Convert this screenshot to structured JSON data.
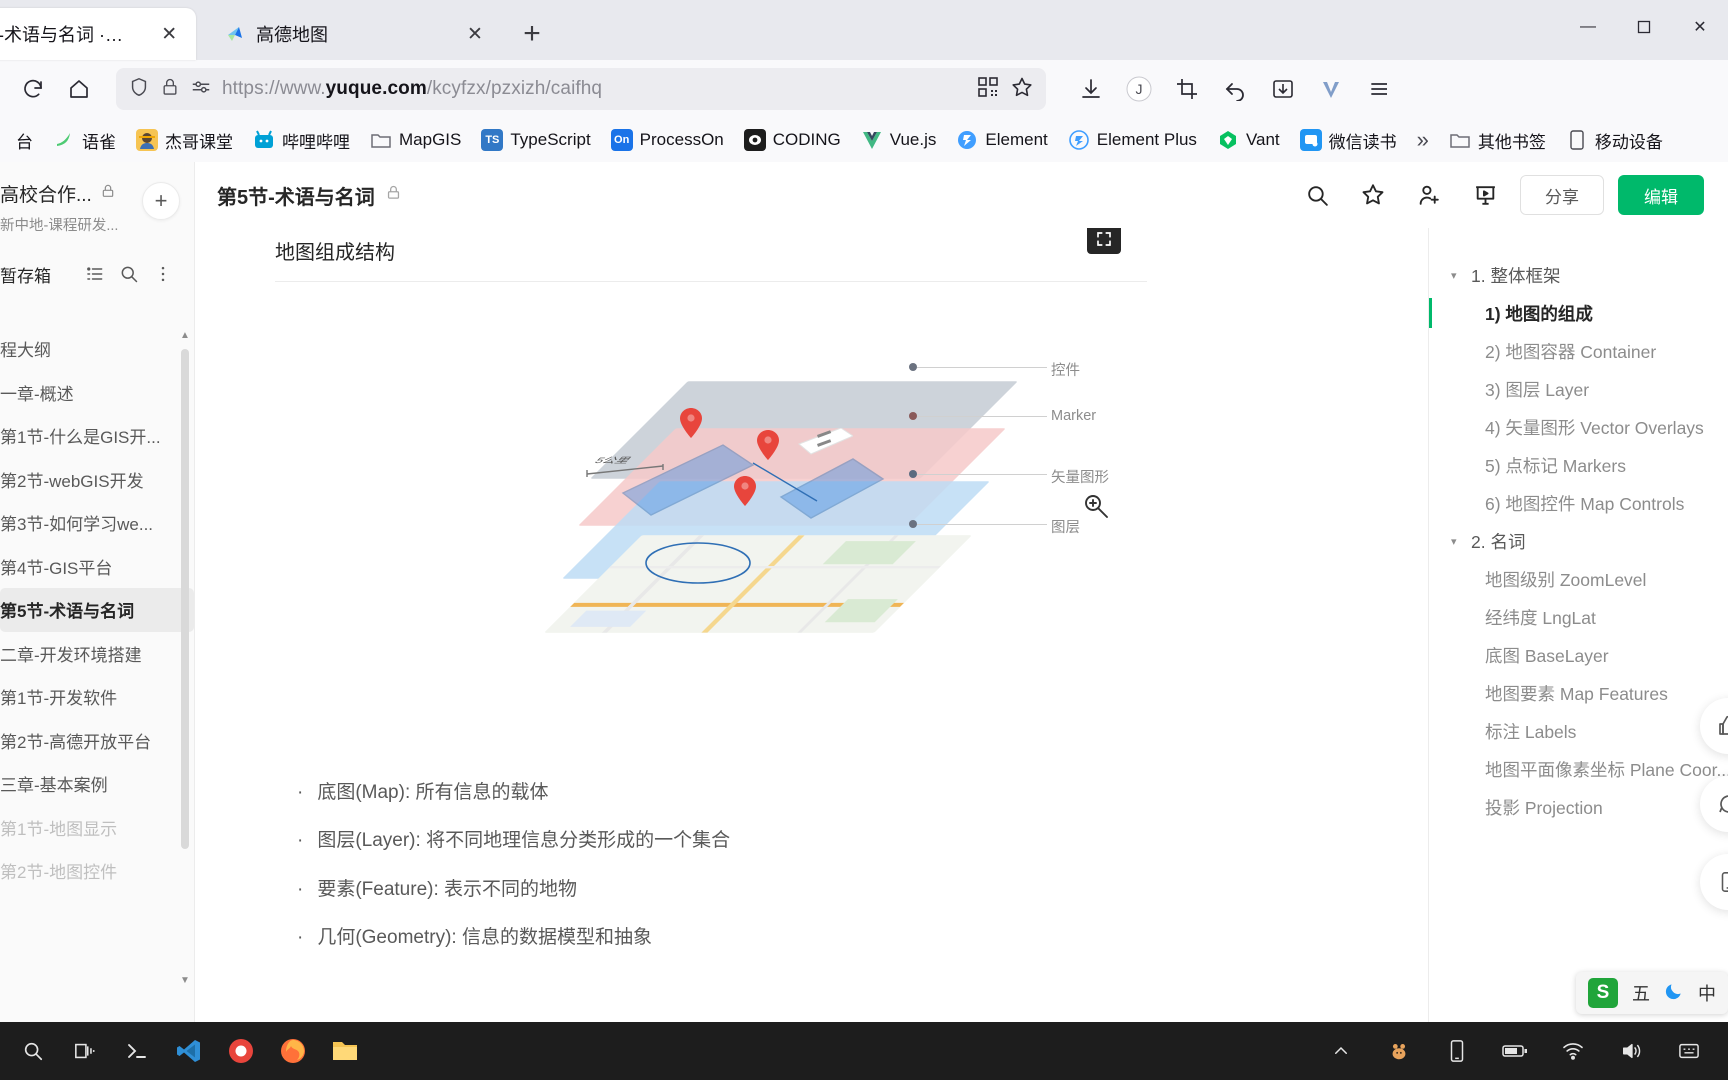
{
  "browser": {
    "tabs": [
      {
        "title": "-术语与名词 · 语雀",
        "favicon": "none",
        "active": true,
        "close_label": "✕"
      },
      {
        "title": "高德地图",
        "favicon": "amap-icon",
        "active": false,
        "close_label": "✕"
      }
    ],
    "newtab_label": "+",
    "window_controls": {
      "minimize": "—",
      "maximize": "▢",
      "close": "✕"
    },
    "nav": {
      "reload_icon": "reload-icon",
      "home_icon": "home-icon",
      "shield_icon": "shield-icon",
      "lock_icon": "lock-icon",
      "permissions_icon": "permissions-icon",
      "url_prefix": "https://www.",
      "url_domain": "yuque.com",
      "url_path": "/kcyfzx/pzxizh/caifhq",
      "qr_icon": "qr-code-icon",
      "bookmark_icon": "star-icon",
      "download_icon": "download-icon",
      "account_icon": "account-avatar",
      "screenshot_icon": "crop-icon",
      "undo_icon": "undo-icon",
      "pocket_icon": "save-to-icon",
      "vimium_icon": "v-extension-icon"
    },
    "bookmarks": [
      {
        "label": "台",
        "icon": "partial",
        "color": "#ffffff"
      },
      {
        "label": "语雀",
        "icon": "yuque-icon",
        "color": "#4ecb73"
      },
      {
        "label": "杰哥课堂",
        "icon": "avatar-icon",
        "color": "#f0c419"
      },
      {
        "label": "哔哩哔哩",
        "icon": "bilibili-icon",
        "color": "#00a1d6"
      },
      {
        "label": "MapGIS",
        "icon": "folder-icon",
        "color": "#8c8c8c"
      },
      {
        "label": "TypeScript",
        "icon": "ts-icon",
        "color": "#3178c6"
      },
      {
        "label": "ProcessOn",
        "icon": "on-icon",
        "color": "#1a73e8"
      },
      {
        "label": "CODING",
        "icon": "coding-icon",
        "color": "#1d1d1d"
      },
      {
        "label": "Vue.js",
        "icon": "vue-icon",
        "color": "#41b883"
      },
      {
        "label": "Element",
        "icon": "element-icon",
        "color": "#409eff"
      },
      {
        "label": "Element Plus",
        "icon": "element-plus-icon",
        "color": "#409eff"
      },
      {
        "label": "Vant",
        "icon": "vant-icon",
        "color": "#07c160"
      },
      {
        "label": "微信读书",
        "icon": "wechat-read-icon",
        "color": "#2196f3"
      }
    ],
    "bookmarks_overflow": "»",
    "other_bookmarks": "其他书签",
    "mobile_bookmarks": "移动设备"
  },
  "sidebar": {
    "workspace_title": "高校合作...",
    "workspace_lock": "lock-icon",
    "workspace_subtitle": "新中地-课程研发...",
    "add_label": "+",
    "section_label": "暂存箱",
    "section_icons": [
      "list-icon",
      "search-icon",
      "more-icon"
    ],
    "items": [
      {
        "label": "程大纲",
        "state": "normal"
      },
      {
        "label": "一章-概述",
        "state": "normal"
      },
      {
        "label": "第1节-什么是GIS开...",
        "state": "normal"
      },
      {
        "label": "第2节-webGIS开发",
        "state": "normal"
      },
      {
        "label": "第3节-如何学习we...",
        "state": "normal"
      },
      {
        "label": "第4节-GIS平台",
        "state": "normal"
      },
      {
        "label": "第5节-术语与名词",
        "state": "active"
      },
      {
        "label": "二章-开发环境搭建",
        "state": "normal"
      },
      {
        "label": "第1节-开发软件",
        "state": "normal"
      },
      {
        "label": "第2节-高德开放平台",
        "state": "normal"
      },
      {
        "label": "三章-基本案例",
        "state": "normal"
      },
      {
        "label": "第1节-地图显示",
        "state": "dim"
      },
      {
        "label": "第2节-地图控件",
        "state": "dim"
      }
    ]
  },
  "document": {
    "title": "第5节-术语与名词",
    "title_lock": "lock-icon",
    "toolbar": {
      "search_icon": "search-icon",
      "star_icon": "star-icon",
      "invite_icon": "add-user-icon",
      "present_icon": "present-icon",
      "share_label": "分享",
      "edit_label": "编辑"
    },
    "heading": "地图组成结构",
    "fullscreen_icon": "fullscreen-icon",
    "figure": {
      "alt": "地图组成结构分层示意图",
      "scale_label": "5公里",
      "callouts": [
        {
          "label": "控件",
          "color": "#9aa3b0"
        },
        {
          "label": "Marker",
          "color": "#c98a8a"
        },
        {
          "label": "矢量图形",
          "color": "#8aa8c9"
        },
        {
          "label": "图层",
          "color": "#8c8c8c"
        }
      ],
      "cursor_icon": "zoom-in-cursor"
    },
    "bullets": [
      "底图(Map): 所有信息的载体",
      "图层(Layer): 将不同地理信息分类形成的一个集合",
      "要素(Feature): 表示不同的地物",
      "几何(Geometry): 信息的数据模型和抽象"
    ]
  },
  "toc": {
    "items": [
      {
        "label": "1. 整体框架",
        "level": 1,
        "caret": "▾",
        "active": false
      },
      {
        "label": "1) 地图的组成",
        "level": 2,
        "active": true
      },
      {
        "label": "2) 地图容器 Container",
        "level": 2,
        "active": false
      },
      {
        "label": "3) 图层 Layer",
        "level": 2,
        "active": false
      },
      {
        "label": "4) 矢量图形 Vector Overlays",
        "level": 2,
        "active": false
      },
      {
        "label": "5) 点标记 Markers",
        "level": 2,
        "active": false
      },
      {
        "label": "6) 地图控件 Map Controls",
        "level": 2,
        "active": false
      },
      {
        "label": "2. 名词",
        "level": 1,
        "caret": "▾",
        "active": false
      },
      {
        "label": "地图级别 ZoomLevel",
        "level": 2,
        "active": false
      },
      {
        "label": "经纬度 LngLat",
        "level": 2,
        "active": false
      },
      {
        "label": "底图 BaseLayer",
        "level": 2,
        "active": false
      },
      {
        "label": "地图要素 Map Features",
        "level": 2,
        "active": false
      },
      {
        "label": "标注 Labels",
        "level": 2,
        "active": false
      },
      {
        "label": "地图平面像素坐标 Plane Coor...",
        "level": 2,
        "active": false
      },
      {
        "label": "投影 Projection",
        "level": 2,
        "active": false
      }
    ]
  },
  "float_buttons": [
    {
      "icon": "thumbs-up-icon"
    },
    {
      "icon": "comment-icon"
    },
    {
      "icon": "mobile-icon"
    }
  ],
  "ime": {
    "logo": "S",
    "mode_label": "五",
    "moon_icon": "moon-icon",
    "menu_label": "中"
  },
  "taskbar": {
    "items": [
      {
        "icon": "search-icon",
        "name": "search"
      },
      {
        "icon": "taskview-icon",
        "name": "task-view"
      },
      {
        "icon": "terminal-icon",
        "name": "terminal"
      },
      {
        "icon": "vscode-icon",
        "name": "vscode"
      },
      {
        "icon": "camera-icon",
        "name": "screen-recorder"
      },
      {
        "icon": "firefox-icon",
        "name": "firefox"
      },
      {
        "icon": "explorer-icon",
        "name": "file-explorer"
      }
    ],
    "tray": [
      {
        "icon": "chevron-up-icon",
        "name": "show-hidden"
      },
      {
        "icon": "pet-icon",
        "name": "tray-app"
      },
      {
        "icon": "phone-icon",
        "name": "phone-link"
      },
      {
        "icon": "battery-icon",
        "name": "battery"
      },
      {
        "icon": "wifi-icon",
        "name": "network"
      },
      {
        "icon": "volume-icon",
        "name": "volume"
      },
      {
        "icon": "ime-icon",
        "name": "input-method"
      }
    ]
  },
  "colors": {
    "accent_green": "#00b96b",
    "tab_active_bg": "#ffffff",
    "chrome_bg": "#f9f9fb",
    "taskbar_bg": "#1d1d1d"
  }
}
